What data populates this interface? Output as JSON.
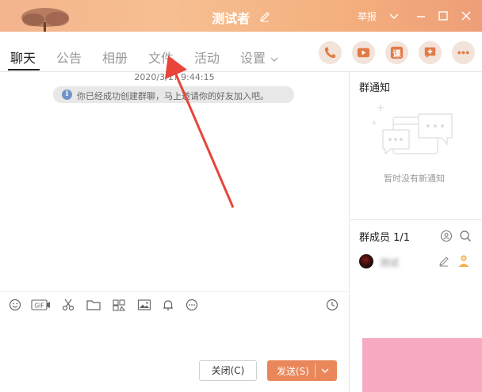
{
  "window": {
    "title": "测试者",
    "report_label": "举报",
    "brand_color": "#f4b48d"
  },
  "tabs": [
    {
      "label": "聊天",
      "active": true
    },
    {
      "label": "公告",
      "active": false
    },
    {
      "label": "相册",
      "active": false
    },
    {
      "label": "文件",
      "active": false
    },
    {
      "label": "活动",
      "active": false
    },
    {
      "label": "设置",
      "active": false
    }
  ],
  "actions": [
    {
      "icon": "phone-icon"
    },
    {
      "icon": "video-icon"
    },
    {
      "icon": "class-icon",
      "glyph": "课"
    },
    {
      "icon": "add-app-icon"
    },
    {
      "icon": "more-icon"
    }
  ],
  "chat": {
    "timestamp": "2020/3/1? 9:44:15",
    "system_notice": "你已经成功创建群聊，马上邀请你的好友加入吧。"
  },
  "toolbar": {
    "items": [
      "emoji-icon",
      "gif-icon",
      "screenshot-icon",
      "folder-icon",
      "image-library-icon",
      "image-icon",
      "bell-icon",
      "more-tools-icon"
    ],
    "history_icon": "clock-icon",
    "gif_label": "GIF"
  },
  "input": {
    "close_label": "关闭(C)",
    "send_label": "发送(S)"
  },
  "right_panel": {
    "notice_title": "群通知",
    "empty_text": "暂时没有新通知",
    "members_title": "群成员 1/1",
    "members": [
      {
        "name": "测试"
      }
    ]
  },
  "colors": {
    "accent": "#e9875a",
    "action_bg": "#f2e3db",
    "annotation": "#e8443a",
    "overlay": "#f7a9c2"
  }
}
